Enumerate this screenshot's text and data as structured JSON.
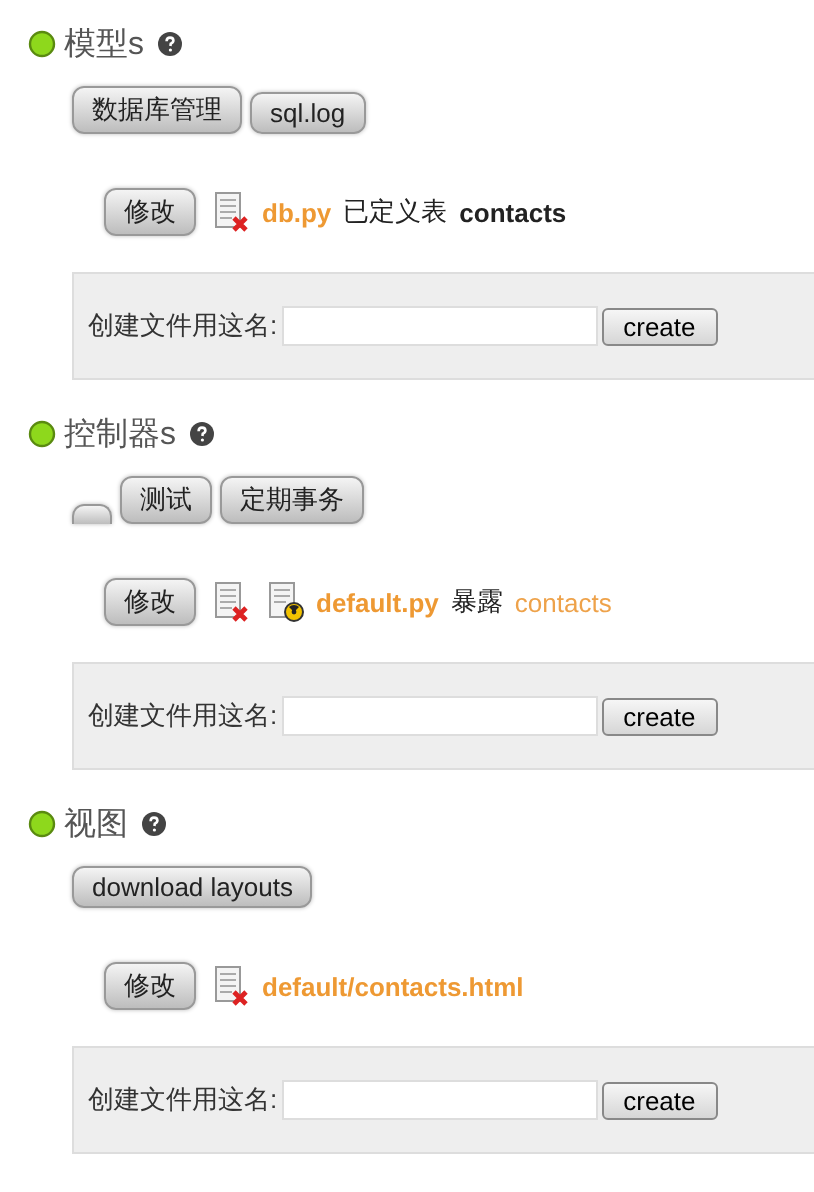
{
  "sections": [
    {
      "title": "模型s",
      "buttons": [
        {
          "kind": "text",
          "label": "数据库管理"
        },
        {
          "kind": "text",
          "label": "sql.log"
        }
      ],
      "files": [
        {
          "edit": "修改",
          "icons": [
            {
              "kind": "delete"
            }
          ],
          "name": "db.py",
          "note": "已定义表",
          "target": {
            "kind": "bold",
            "text": "contacts"
          }
        }
      ],
      "create": {
        "label": "创建文件用这名:",
        "button": "create"
      }
    },
    {
      "title": "控制器s",
      "buttons": [
        {
          "kind": "blank"
        },
        {
          "kind": "text",
          "label": "测试"
        },
        {
          "kind": "text",
          "label": "定期事务"
        }
      ],
      "files": [
        {
          "edit": "修改",
          "icons": [
            {
              "kind": "delete"
            },
            {
              "kind": "test"
            }
          ],
          "name": "default.py",
          "note": "暴露",
          "target": {
            "kind": "link",
            "text": "contacts"
          }
        }
      ],
      "create": {
        "label": "创建文件用这名:",
        "button": "create"
      }
    },
    {
      "title": "视图",
      "buttons": [
        {
          "kind": "text",
          "label": "download layouts"
        }
      ],
      "files": [
        {
          "edit": "修改",
          "icons": [
            {
              "kind": "delete"
            }
          ],
          "name": "default/contacts.html"
        }
      ],
      "create": {
        "label": "创建文件用这名:",
        "button": "create"
      }
    }
  ]
}
